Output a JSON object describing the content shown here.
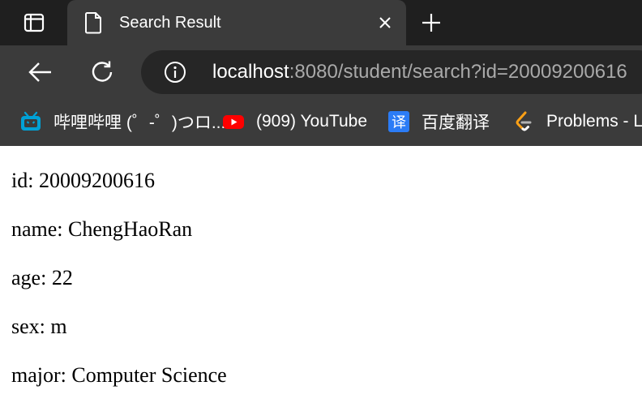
{
  "tab": {
    "title": "Search Result"
  },
  "address_bar": {
    "host": "localhost",
    "path": ":8080/student/search?id=20009200616"
  },
  "bookmarks": [
    {
      "label": "哔哩哔哩 (゜-゜)つロ...",
      "icon": "bilibili-icon"
    },
    {
      "label": "(909) YouTube",
      "icon": "youtube-icon"
    },
    {
      "label": "百度翻译",
      "icon": "baidu-translate-icon"
    },
    {
      "label": "Problems - Le",
      "icon": "leetcode-icon"
    }
  ],
  "student": {
    "id_label": "id:",
    "id": "20009200616",
    "name_label": "name:",
    "name": "ChengHaoRan",
    "age_label": "age:",
    "age": "22",
    "sex_label": "sex:",
    "sex": "m",
    "major_label": "major:",
    "major": "Computer Science"
  },
  "colors": {
    "tabstrip": "#1f1f1f",
    "toolbar": "#3b3b3b",
    "omnibox": "#262626",
    "bilibili": "#00a1d6",
    "youtube": "#ff0000",
    "baidu_translate": "#2b7cf6",
    "leetcode_orange": "#ffa116"
  }
}
